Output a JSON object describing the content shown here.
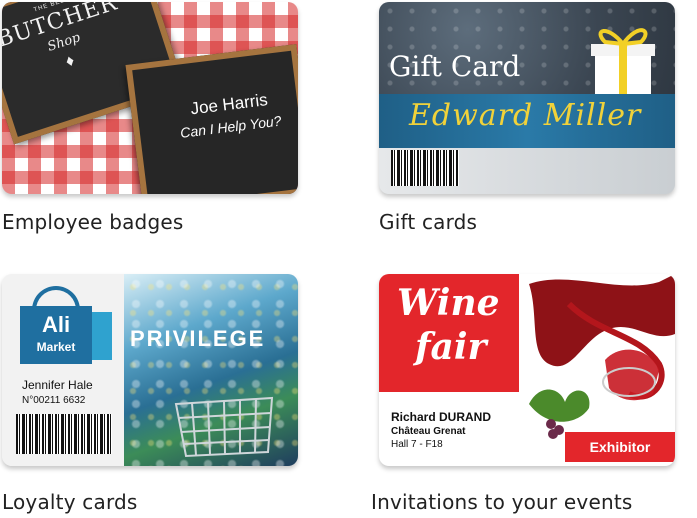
{
  "cards": [
    {
      "caption": "Employee badges",
      "badge_small": "THE BEST",
      "shop_title": "BUTCHER",
      "shop_sub": "Shop",
      "person": "Joe Harris",
      "message": "Can I Help You?"
    },
    {
      "caption": "Gift cards",
      "title": "Gift Card",
      "name": "Edward Miller"
    },
    {
      "caption": "Loyalty cards",
      "brand": "Ali",
      "brand_sub": "Market",
      "person": "Jennifer Hale",
      "number": "N°00211 6632",
      "banner": "PRIVILEGE"
    },
    {
      "caption": "Invitations to your events",
      "title1": "Wine",
      "title2": "fair",
      "person": "Richard DURAND",
      "company": "Château Grenat",
      "location": "Hall 7 - F18",
      "badge": "Exhibitor"
    }
  ],
  "colors": {
    "butcher_red": "#d62828",
    "frame_wood": "#a5743f",
    "gift_blue": "#1f5f86",
    "gift_gold": "#f1d23a",
    "loyalty_blue": "#1f6fa0",
    "wine_red": "#e3262b"
  }
}
